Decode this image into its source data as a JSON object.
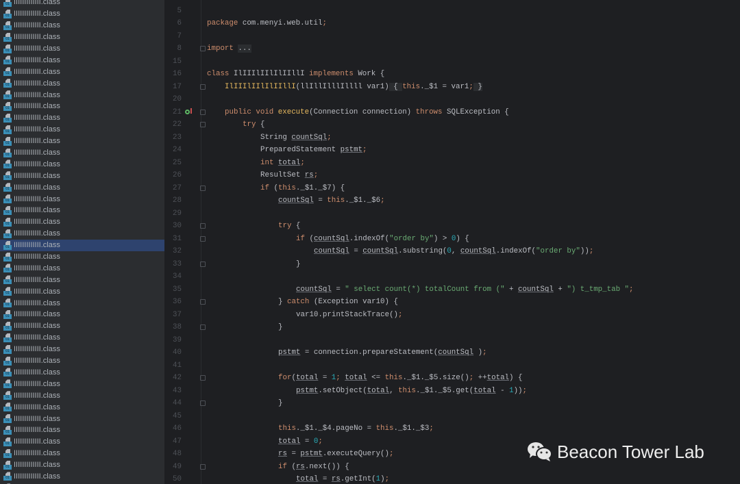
{
  "sidebar": {
    "file_label": "IIIIIIIIIIIII.class",
    "count": 43,
    "selected_index": 21
  },
  "editor": {
    "lines": [
      {
        "n": "",
        "t": [
          [
            "c",
            "*/"
          ]
        ]
      },
      {
        "n": "5",
        "t": []
      },
      {
        "n": "6",
        "t": [
          [
            "k",
            "package "
          ],
          [
            "",
            "com.menyi.web.util"
          ],
          [
            "k",
            ";"
          ]
        ]
      },
      {
        "n": "7",
        "t": []
      },
      {
        "n": "8",
        "fold": true,
        "t": [
          [
            "k",
            "import "
          ],
          [
            "b",
            "..."
          ]
        ]
      },
      {
        "n": "15",
        "t": []
      },
      {
        "n": "16",
        "t": [
          [
            "k",
            "class "
          ],
          [
            "",
            "IlIIIlIIlIlIIllI "
          ],
          [
            "k",
            "implements "
          ],
          [
            "",
            "Work {"
          ]
        ]
      },
      {
        "n": "17",
        "fold": true,
        "i": 1,
        "t": [
          [
            "f",
            "IlIIIlIIlIlIIllI"
          ],
          [
            "",
            "(llIllIlllIllll var1)"
          ],
          [
            "b",
            " { "
          ],
          [
            "k",
            "this"
          ],
          [
            "",
            "._$1 = var1"
          ],
          [
            "k",
            ";"
          ],
          [
            "b",
            " }"
          ]
        ]
      },
      {
        "n": "20",
        "t": []
      },
      {
        "n": "21",
        "fold": true,
        "gutter": "override-icon",
        "i": 1,
        "t": [
          [
            "k",
            "public void "
          ],
          [
            "f",
            "execute"
          ],
          [
            "",
            "(Connection connection) "
          ],
          [
            "k",
            "throws "
          ],
          [
            "",
            "SQLException {"
          ]
        ]
      },
      {
        "n": "22",
        "fold": true,
        "i": 2,
        "t": [
          [
            "k",
            "try "
          ],
          [
            "",
            "{"
          ]
        ]
      },
      {
        "n": "23",
        "i": 3,
        "t": [
          [
            "",
            "String "
          ],
          [
            "u",
            "countSql"
          ],
          [
            "k",
            ";"
          ]
        ]
      },
      {
        "n": "24",
        "i": 3,
        "t": [
          [
            "",
            "PreparedStatement "
          ],
          [
            "u",
            "pstmt"
          ],
          [
            "k",
            ";"
          ]
        ]
      },
      {
        "n": "25",
        "i": 3,
        "t": [
          [
            "k",
            "int "
          ],
          [
            "u",
            "total"
          ],
          [
            "k",
            ";"
          ]
        ]
      },
      {
        "n": "26",
        "i": 3,
        "t": [
          [
            "",
            "ResultSet "
          ],
          [
            "u",
            "rs"
          ],
          [
            "k",
            ";"
          ]
        ]
      },
      {
        "n": "27",
        "fold": true,
        "i": 3,
        "t": [
          [
            "k",
            "if "
          ],
          [
            "",
            "("
          ],
          [
            "k",
            "this"
          ],
          [
            "",
            "._$1._$7) {"
          ]
        ]
      },
      {
        "n": "28",
        "i": 4,
        "t": [
          [
            "u",
            "countSql"
          ],
          [
            "",
            " = "
          ],
          [
            "k",
            "this"
          ],
          [
            "",
            "._$1._$6"
          ],
          [
            "k",
            ";"
          ]
        ]
      },
      {
        "n": "29",
        "t": []
      },
      {
        "n": "30",
        "fold": true,
        "i": 4,
        "t": [
          [
            "k",
            "try "
          ],
          [
            "",
            "{"
          ]
        ]
      },
      {
        "n": "31",
        "fold": true,
        "i": 5,
        "t": [
          [
            "k",
            "if "
          ],
          [
            "",
            "("
          ],
          [
            "u",
            "countSql"
          ],
          [
            "",
            ".indexOf("
          ],
          [
            "s",
            "\"order by\""
          ],
          [
            "",
            ") > "
          ],
          [
            "n",
            "0"
          ],
          [
            "",
            ") {"
          ]
        ]
      },
      {
        "n": "32",
        "i": 6,
        "t": [
          [
            "u",
            "countSql"
          ],
          [
            "",
            " = "
          ],
          [
            "u",
            "countSql"
          ],
          [
            "",
            ".substring("
          ],
          [
            "n",
            "0"
          ],
          [
            "",
            ", "
          ],
          [
            "u",
            "countSql"
          ],
          [
            "",
            ".indexOf("
          ],
          [
            "s",
            "\"order by\""
          ],
          [
            "",
            "))"
          ],
          [
            "k",
            ";"
          ]
        ]
      },
      {
        "n": "33",
        "fold": true,
        "i": 5,
        "t": [
          [
            "",
            "}"
          ]
        ]
      },
      {
        "n": "34",
        "t": []
      },
      {
        "n": "35",
        "i": 5,
        "t": [
          [
            "u",
            "countSql"
          ],
          [
            "",
            " = "
          ],
          [
            "s",
            "\" select count(*) totalCount from (\""
          ],
          [
            "",
            " + "
          ],
          [
            "u",
            "countSql"
          ],
          [
            "",
            " + "
          ],
          [
            "s",
            "\") t_tmp_tab \""
          ],
          [
            "k",
            ";"
          ]
        ]
      },
      {
        "n": "36",
        "fold": true,
        "i": 4,
        "t": [
          [
            "",
            "} "
          ],
          [
            "k",
            "catch "
          ],
          [
            "",
            "(Exception var10) {"
          ]
        ]
      },
      {
        "n": "37",
        "i": 5,
        "t": [
          [
            "",
            "var10.printStackTrace()"
          ],
          [
            "k",
            ";"
          ]
        ]
      },
      {
        "n": "38",
        "fold": true,
        "i": 4,
        "t": [
          [
            "",
            "}"
          ]
        ]
      },
      {
        "n": "39",
        "t": []
      },
      {
        "n": "40",
        "i": 4,
        "t": [
          [
            "u",
            "pstmt"
          ],
          [
            "",
            " = connection.prepareStatement("
          ],
          [
            "u",
            "countSql"
          ],
          [
            "",
            " )"
          ],
          [
            "k",
            ";"
          ]
        ]
      },
      {
        "n": "41",
        "t": []
      },
      {
        "n": "42",
        "fold": true,
        "i": 4,
        "t": [
          [
            "k",
            "for"
          ],
          [
            "",
            "("
          ],
          [
            "u",
            "total"
          ],
          [
            "",
            " = "
          ],
          [
            "n",
            "1"
          ],
          [
            "k",
            "; "
          ],
          [
            "u",
            "total"
          ],
          [
            "",
            " <= "
          ],
          [
            "k",
            "this"
          ],
          [
            "",
            "._$1._$5.size()"
          ],
          [
            "k",
            "; "
          ],
          [
            "",
            "++"
          ],
          [
            "u",
            "total"
          ],
          [
            "",
            ") {"
          ]
        ]
      },
      {
        "n": "43",
        "i": 5,
        "t": [
          [
            "u",
            "pstmt"
          ],
          [
            "",
            ".setObject("
          ],
          [
            "u",
            "total"
          ],
          [
            "",
            ", "
          ],
          [
            "k",
            "this"
          ],
          [
            "",
            "._$1._$5.get("
          ],
          [
            "u",
            "total"
          ],
          [
            "",
            " - "
          ],
          [
            "n",
            "1"
          ],
          [
            "",
            "))"
          ],
          [
            "k",
            ";"
          ]
        ]
      },
      {
        "n": "44",
        "fold": true,
        "i": 4,
        "t": [
          [
            "",
            "}"
          ]
        ]
      },
      {
        "n": "45",
        "t": []
      },
      {
        "n": "46",
        "i": 4,
        "t": [
          [
            "k",
            "this"
          ],
          [
            "",
            "._$1._$4.pageNo = "
          ],
          [
            "k",
            "this"
          ],
          [
            "",
            "._$1._$3"
          ],
          [
            "k",
            ";"
          ]
        ]
      },
      {
        "n": "47",
        "i": 4,
        "t": [
          [
            "u",
            "total"
          ],
          [
            "",
            " = "
          ],
          [
            "n",
            "0"
          ],
          [
            "k",
            ";"
          ]
        ]
      },
      {
        "n": "48",
        "i": 4,
        "t": [
          [
            "u",
            "rs"
          ],
          [
            "",
            " = "
          ],
          [
            "u",
            "pstmt"
          ],
          [
            "",
            ".executeQuery()"
          ],
          [
            "k",
            ";"
          ]
        ]
      },
      {
        "n": "49",
        "fold": true,
        "i": 4,
        "t": [
          [
            "k",
            "if "
          ],
          [
            "",
            "("
          ],
          [
            "u",
            "rs"
          ],
          [
            "",
            ".next()) {"
          ]
        ]
      },
      {
        "n": "50",
        "i": 5,
        "t": [
          [
            "u",
            "total"
          ],
          [
            "",
            " = "
          ],
          [
            "u",
            "rs"
          ],
          [
            "",
            ".getInt("
          ],
          [
            "n",
            "1"
          ],
          [
            ")"
          ],
          [
            "k",
            ";"
          ]
        ]
      }
    ]
  },
  "watermark": {
    "text": "Beacon Tower Lab"
  }
}
